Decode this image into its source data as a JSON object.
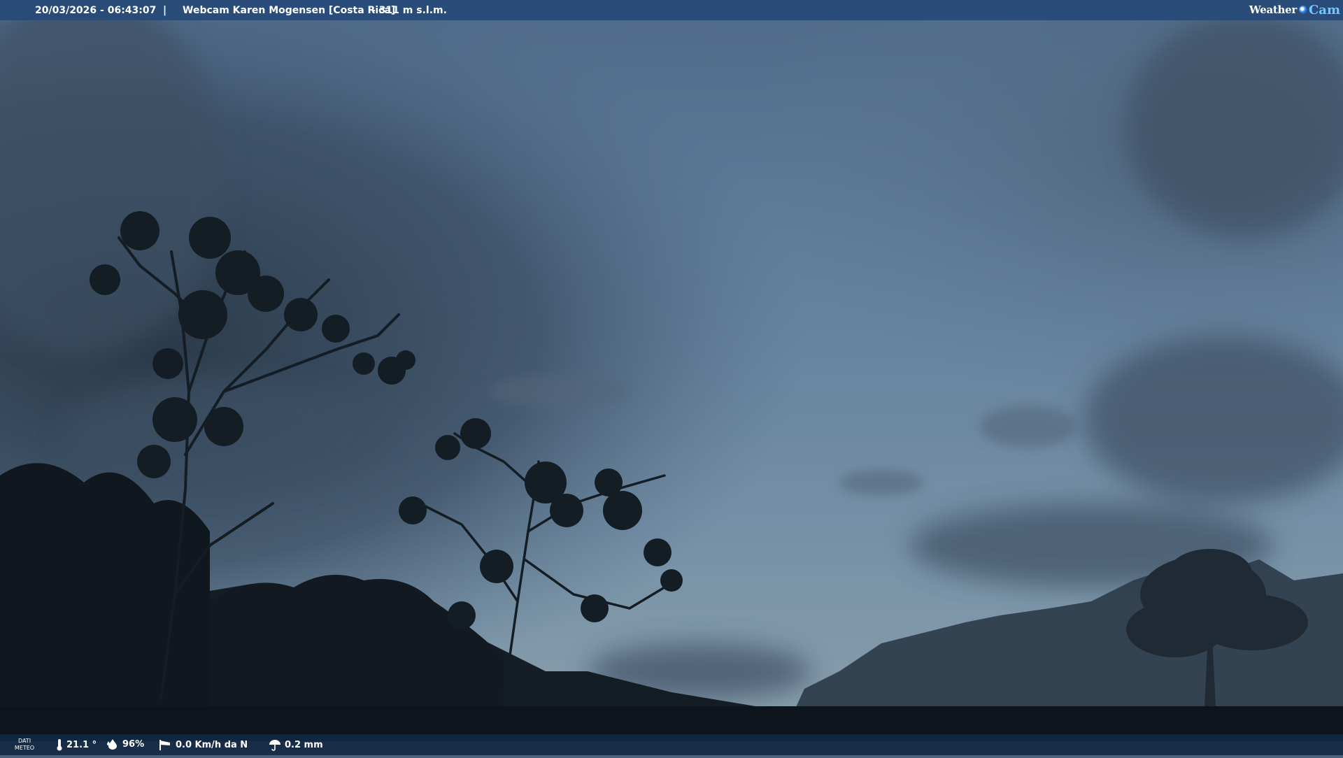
{
  "header": {
    "datetime": "20/03/2026 - 06:43:07",
    "separator": "|",
    "camera_title": "Webcam Karen Mogensen [Costa Rica]",
    "altitude": "- 311 m s.l.m.",
    "logo_text_1": "Weather",
    "logo_text_2": "Cam"
  },
  "footer": {
    "dati_meteo_line1": "DATI",
    "dati_meteo_line2": "METEO",
    "temperature": "21.1 °",
    "humidity": "96%",
    "wind": "0.0 Km/h da N",
    "rain": "0.2 mm"
  },
  "icons": {
    "temperature": "thermometer-icon",
    "humidity": "humidity-drop-icon",
    "wind": "wind-sock-icon",
    "rain": "umbrella-icon",
    "logo": "webcam-lens-icon"
  },
  "colors": {
    "header_bar": "#264a78",
    "footer_bar": "#122842",
    "sky_top": "#5a7693",
    "sky_bottom": "#7f98a8",
    "logo_accent": "#6fc7ff"
  }
}
